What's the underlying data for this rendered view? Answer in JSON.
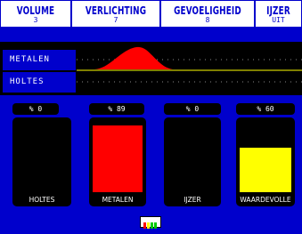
{
  "header": {
    "items": [
      {
        "label": "VOLUME",
        "value": "3"
      },
      {
        "label": "VERLICHTING",
        "value": "7"
      },
      {
        "label": "GEVOELIGHEID",
        "value": "8"
      },
      {
        "label": "IJZER",
        "value": "UIT"
      }
    ]
  },
  "graph": {
    "rows": [
      {
        "label": "METALEN"
      },
      {
        "label": "HOLTES"
      }
    ]
  },
  "meters": [
    {
      "percent_label": "% 0",
      "label": "HOLTES",
      "level": 0,
      "color": "#000000"
    },
    {
      "percent_label": "% 89",
      "label": "METALEN",
      "level": 89,
      "color": "#ff0000"
    },
    {
      "percent_label": "% 0",
      "label": "IJZER",
      "level": 0,
      "color": "#000000"
    },
    {
      "percent_label": "% 60",
      "label": "WAARDEVOLLE",
      "level": 60,
      "color": "#ffff00"
    }
  ],
  "colors": {
    "accent_blue": "#0000cc",
    "metal_curve": "#ff0000",
    "separator": "#ffff00"
  },
  "battery": {
    "icon": "battery-icon",
    "cells": [
      "#ff0000",
      "#ffff00",
      "#00cc00",
      "#00cc00"
    ]
  }
}
